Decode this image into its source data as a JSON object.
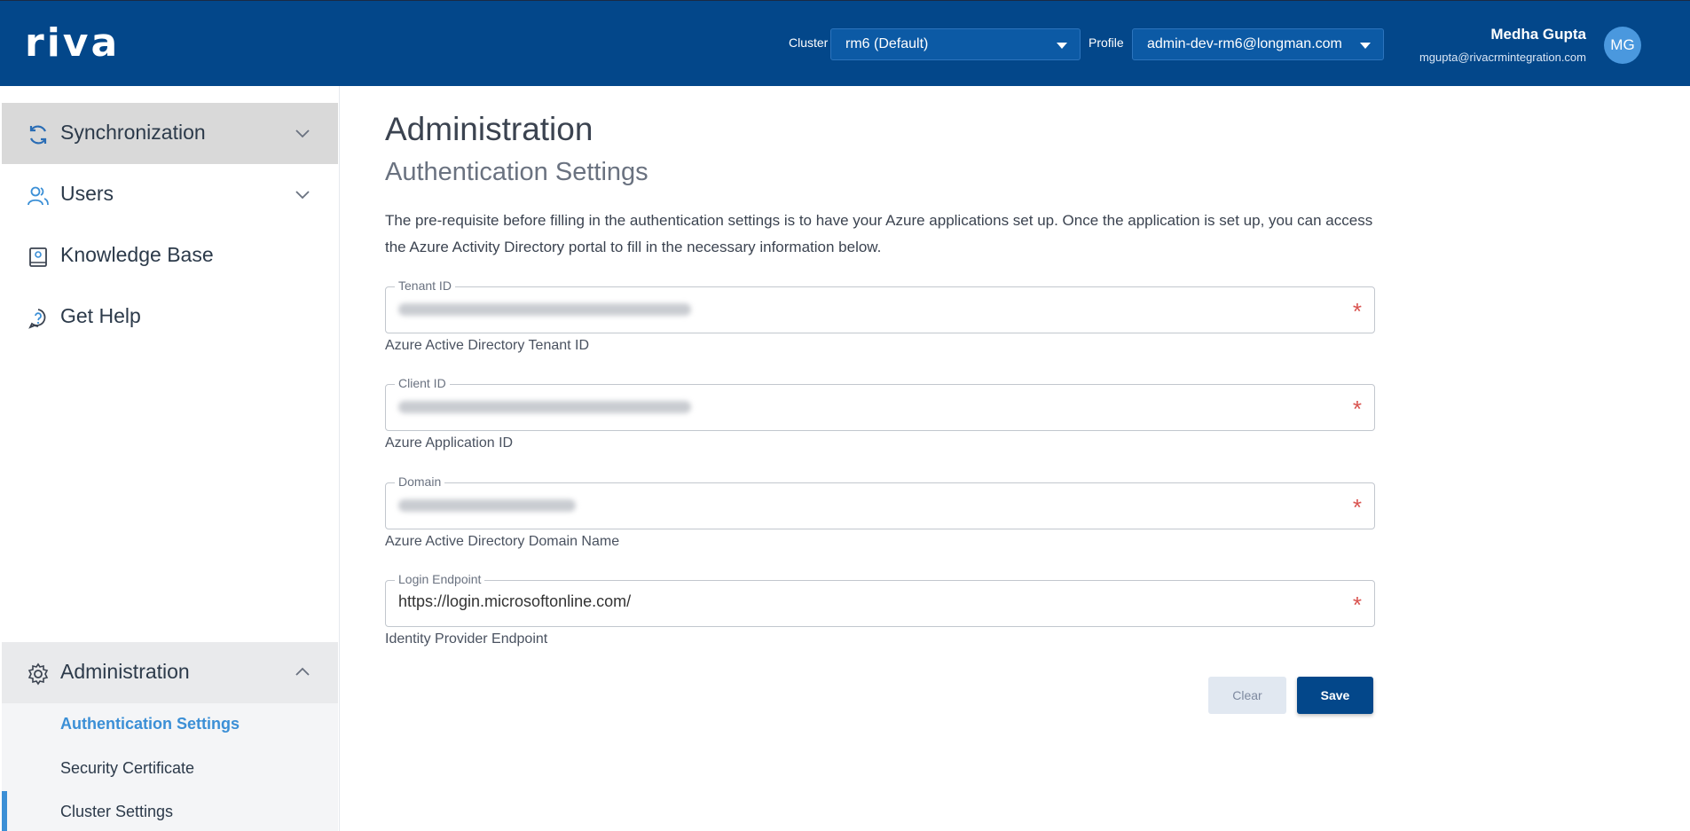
{
  "header": {
    "logo_text": "riva",
    "cluster_label": "Cluster",
    "cluster_value": "rm6 (Default)",
    "profile_label": "Profile",
    "profile_value": "admin-dev-rm6@longman.com",
    "user_name": "Medha Gupta",
    "user_email": "mgupta@rivacrmintegration.com",
    "avatar_initials": "MG"
  },
  "sidebar": {
    "items": [
      {
        "label": "Synchronization",
        "icon": "sync-icon"
      },
      {
        "label": "Users",
        "icon": "users-icon"
      },
      {
        "label": "Knowledge Base",
        "icon": "book-icon"
      },
      {
        "label": "Get Help",
        "icon": "help-icon"
      }
    ],
    "admin": {
      "label": "Administration",
      "icon": "gear-icon",
      "sub_items": [
        {
          "label": "Authentication Settings",
          "active": true
        },
        {
          "label": "Security Certificate"
        },
        {
          "label": "Cluster Settings"
        }
      ]
    }
  },
  "main": {
    "title": "Administration",
    "subtitle": "Authentication Settings",
    "description": "The pre-requisite before filling in the authentication settings is to have your Azure applications set up. Once the application is set up, you can access the Azure Activity Directory portal to fill in the necessary information below.",
    "fields": [
      {
        "label": "Tenant ID",
        "value": "",
        "helper": "Azure Active Directory Tenant ID",
        "required": "*"
      },
      {
        "label": "Client ID",
        "value": "",
        "helper": "Azure Application ID",
        "required": "*"
      },
      {
        "label": "Domain",
        "value": "",
        "helper": "Azure Active Directory Domain Name",
        "required": "*"
      },
      {
        "label": "Login Endpoint",
        "value": "https://login.microsoftonline.com/",
        "helper": "Identity Provider Endpoint",
        "required": "*"
      }
    ],
    "buttons": {
      "clear": "Clear",
      "save": "Save"
    }
  },
  "colors": {
    "header_bg": "#03478a",
    "accent": "#3b8fd6",
    "required": "#d9534f"
  }
}
